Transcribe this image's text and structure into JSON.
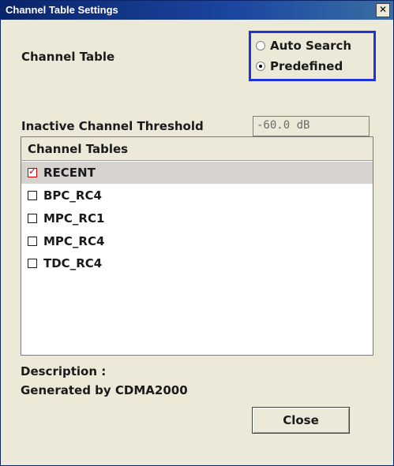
{
  "window": {
    "title": "Channel Table Settings",
    "close_glyph": "✕"
  },
  "channel_table": {
    "label": "Channel Table",
    "options": [
      {
        "label": "Auto Search",
        "checked": false
      },
      {
        "label": "Predefined",
        "checked": true
      }
    ]
  },
  "threshold": {
    "label": "Inactive Channel Threshold",
    "value": "-60.0 dB"
  },
  "channel_tables": {
    "header": "Channel Tables",
    "items": [
      {
        "label": "RECENT",
        "checked": true,
        "selected": true
      },
      {
        "label": "BPC_RC4",
        "checked": false,
        "selected": false
      },
      {
        "label": "MPC_RC1",
        "checked": false,
        "selected": false
      },
      {
        "label": "MPC_RC4",
        "checked": false,
        "selected": false
      },
      {
        "label": "TDC_RC4",
        "checked": false,
        "selected": false
      }
    ]
  },
  "description": {
    "label": "Description :",
    "text": "Generated by CDMA2000"
  },
  "buttons": {
    "close_label": "Close"
  }
}
